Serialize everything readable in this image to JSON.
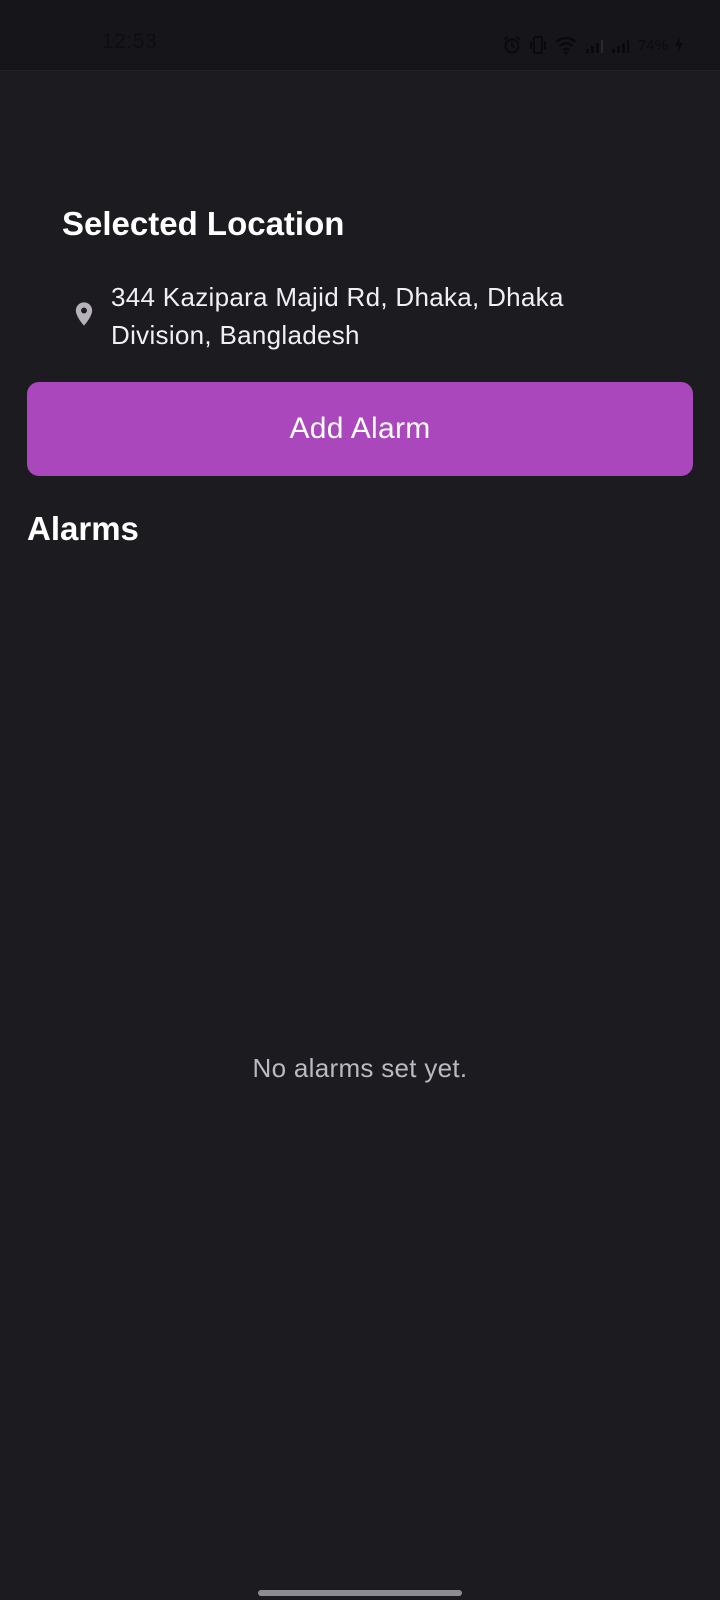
{
  "status_bar": {
    "time": "12:53",
    "battery": "74%",
    "icons": [
      "alarm-icon",
      "vibrate-icon",
      "wifi-icon",
      "signal-icon",
      "signal-icon",
      "charging-icon"
    ]
  },
  "location": {
    "title": "Selected Location",
    "address": "344 Kazipara Majid Rd, Dhaka, Dhaka Division, Bangladesh",
    "icon": "location-pin-icon"
  },
  "actions": {
    "add_alarm_label": "Add Alarm"
  },
  "alarms": {
    "title": "Alarms",
    "empty_message": "No alarms set yet."
  },
  "colors": {
    "background": "#1c1b20",
    "accent": "#ab47bc",
    "text": "#ffffff",
    "muted_text": "#bdb9c2"
  }
}
